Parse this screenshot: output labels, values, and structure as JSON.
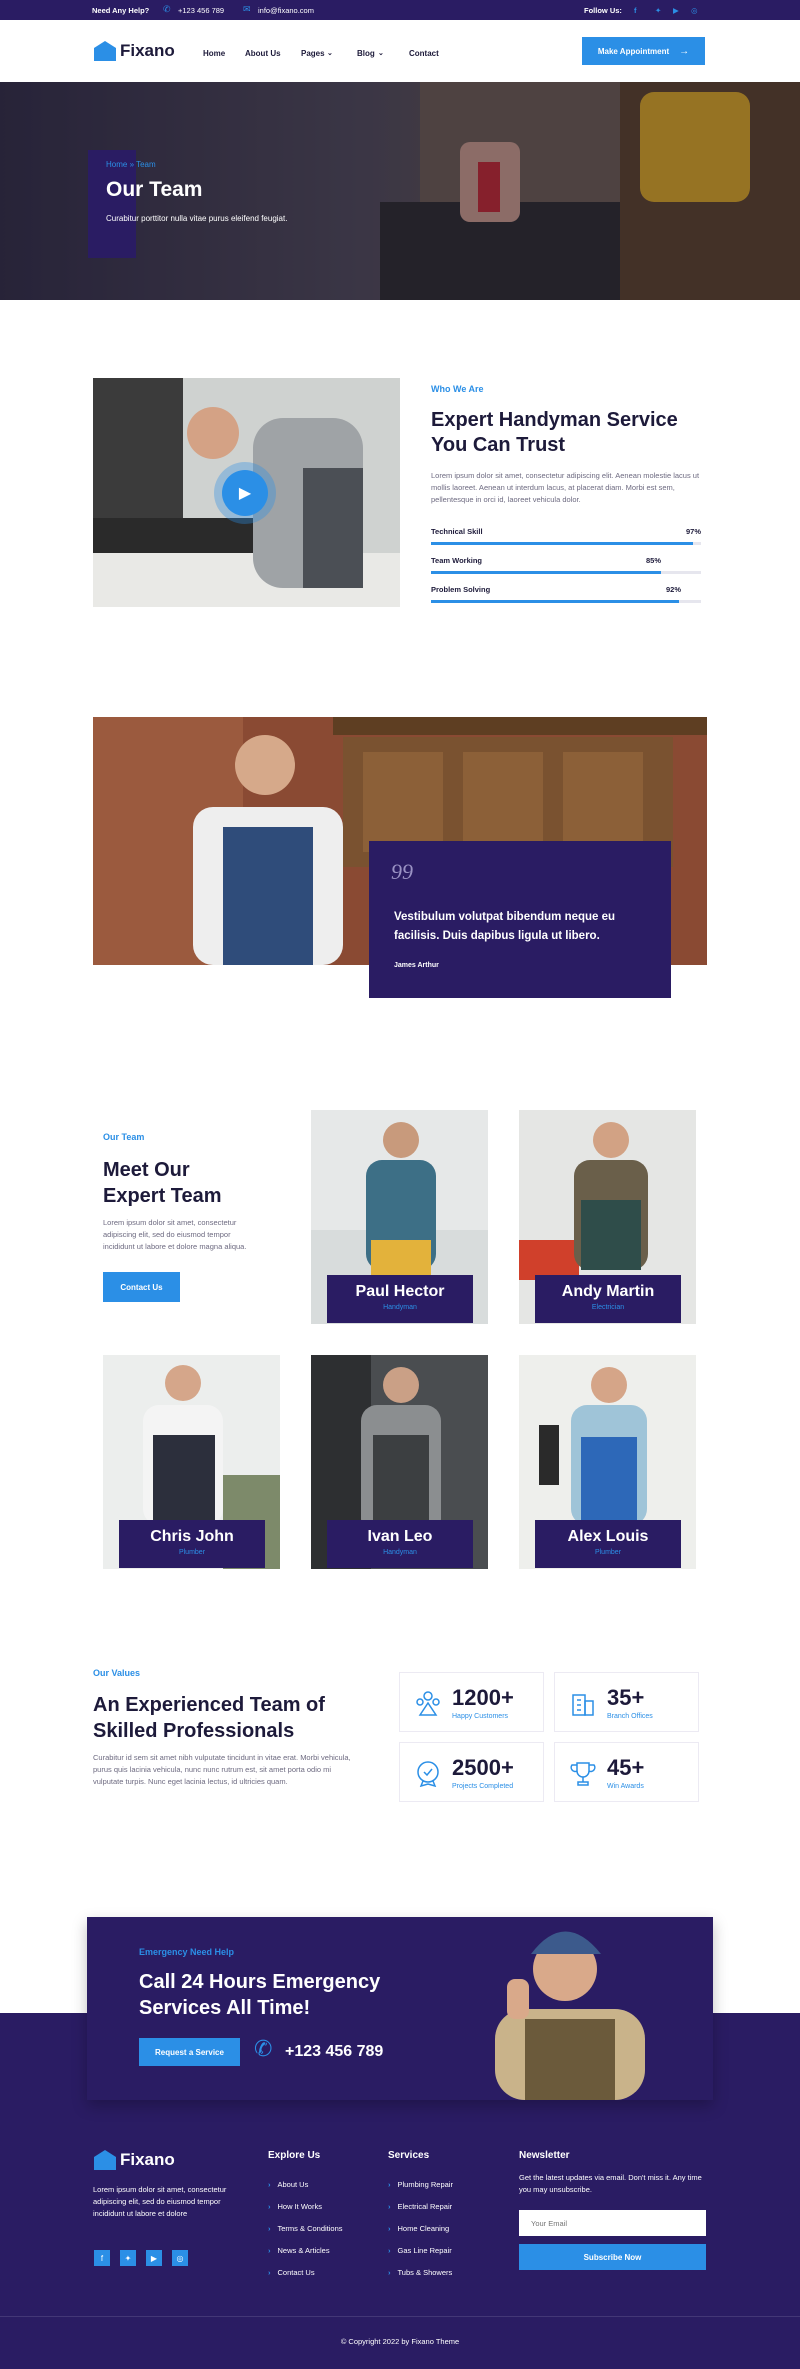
{
  "topbar": {
    "help_label": "Need Any Help?",
    "phone": "+123 456 789",
    "email": "info@fixano.com",
    "follow_label": "Follow Us:"
  },
  "brand": {
    "name": "Fixano"
  },
  "nav": {
    "items": [
      "Home",
      "About Us",
      "Pages",
      "Blog",
      "Contact"
    ],
    "cta": "Make Appointment"
  },
  "hero": {
    "breadcrumb": "Home » Team",
    "title": "Our Team",
    "subtitle": "Curabitur porttitor nulla vitae purus eleifend feugiat."
  },
  "about": {
    "kicker": "Who We Are",
    "title_line1": "Expert Handyman Service",
    "title_line2": "You Can Trust",
    "body": "Lorem ipsum dolor sit amet, consectetur adipiscing elit. Aenean molestie lacus ut mollis laoreet. Aenean ut interdum lacus, at placerat diam. Morbi est sem, pellentesque in orci id, laoreet vehicula dolor.",
    "skills": [
      {
        "label": "Technical Skill",
        "value": "97%",
        "fraction": 0.97
      },
      {
        "label": "Team Working",
        "value": "85%",
        "fraction": 0.85
      },
      {
        "label": "Problem Solving",
        "value": "92%",
        "fraction": 0.92
      }
    ]
  },
  "quote": {
    "mark": "99",
    "text_line1": "Vestibulum volutpat bibendum neque eu",
    "text_line2": "facilisis. Duis dapibus ligula ut libero.",
    "author": "James Arthur"
  },
  "team": {
    "kicker": "Our Team",
    "title_line1": "Meet Our",
    "title_line2": "Expert Team",
    "body": "Lorem ipsum dolor sit amet, consectetur adipiscing elit, sed do eiusmod tempor incididunt ut labore et dolore magna aliqua.",
    "cta": "Contact Us",
    "members": [
      {
        "name": "Paul Hector",
        "role": "Handyman"
      },
      {
        "name": "Andy Martin",
        "role": "Electrician"
      },
      {
        "name": "Chris John",
        "role": "Plumber"
      },
      {
        "name": "Ivan Leo",
        "role": "Handyman"
      },
      {
        "name": "Alex Louis",
        "role": "Plumber"
      }
    ]
  },
  "values": {
    "kicker": "Our Values",
    "title_line1": "An Experienced Team of",
    "title_line2": "Skilled Professionals",
    "body": "Curabitur id sem sit amet nibh vulputate tincidunt in vitae erat. Morbi vehicula, purus quis lacinia vehicula, nunc nunc rutrum est, sit amet porta odio mi vulputate turpis. Nunc eget lacinia lectus, id ultricies quam.",
    "stats": [
      {
        "number": "1200+",
        "label": "Happy Customers",
        "icon": "team-icon"
      },
      {
        "number": "35+",
        "label": "Branch Offices",
        "icon": "building-icon"
      },
      {
        "number": "2500+",
        "label": "Projects Completed",
        "icon": "badge-icon"
      },
      {
        "number": "45+",
        "label": "Win Awards",
        "icon": "trophy-icon"
      }
    ]
  },
  "emergency": {
    "kicker": "Emergency Need Help",
    "title_line1": "Call 24 Hours Emergency",
    "title_line2": "Services All Time!",
    "cta": "Request a Service",
    "phone": "+123 456 789"
  },
  "footer": {
    "about": "Lorem ipsum dolor sit amet, consectetur adipiscing elit, sed do eiusmod tempor incididunt ut labore et dolore",
    "explore_title": "Explore Us",
    "explore": [
      "About Us",
      "How It Works",
      "Terms & Conditions",
      "News & Articles",
      "Contact Us"
    ],
    "services_title": "Services",
    "services": [
      "Plumbing Repair",
      "Electrical Repair",
      "Home Cleaning",
      "Gas Line Repair",
      "Tubs & Showers"
    ],
    "newsletter_title": "Newsletter",
    "newsletter_text": "Get the latest updates via email. Don't miss it. Any time you may unsubscribe.",
    "email_placeholder": "Your Email",
    "subscribe": "Subscribe Now",
    "copyright": "© Copyright 2022 by Fixano Theme"
  },
  "colors": {
    "primary": "#2a1c63",
    "accent": "#2b8fe6"
  }
}
